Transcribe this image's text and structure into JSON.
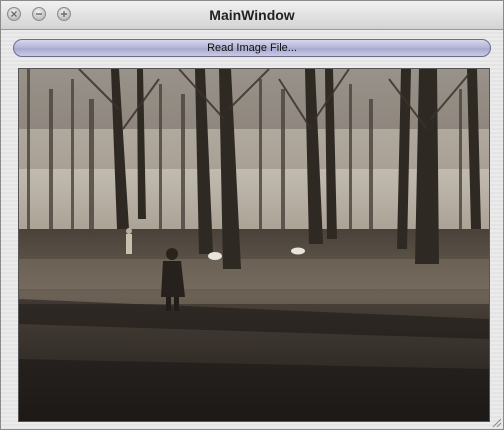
{
  "window": {
    "title": "MainWindow",
    "controls": [
      "close",
      "minimize",
      "zoom"
    ]
  },
  "toolbar": {
    "read_button_label": "Read Image File..."
  },
  "image": {
    "description_icon": "photo-forest-scene",
    "colors": {
      "sky": "#dcd8cf",
      "ground_dark": "#2b2622",
      "ground_light": "#7a6f62",
      "trunk": "#3a332d"
    }
  },
  "colors": {
    "button_fill": "#b7b7d8",
    "window_bg": "#e8e8e8"
  }
}
